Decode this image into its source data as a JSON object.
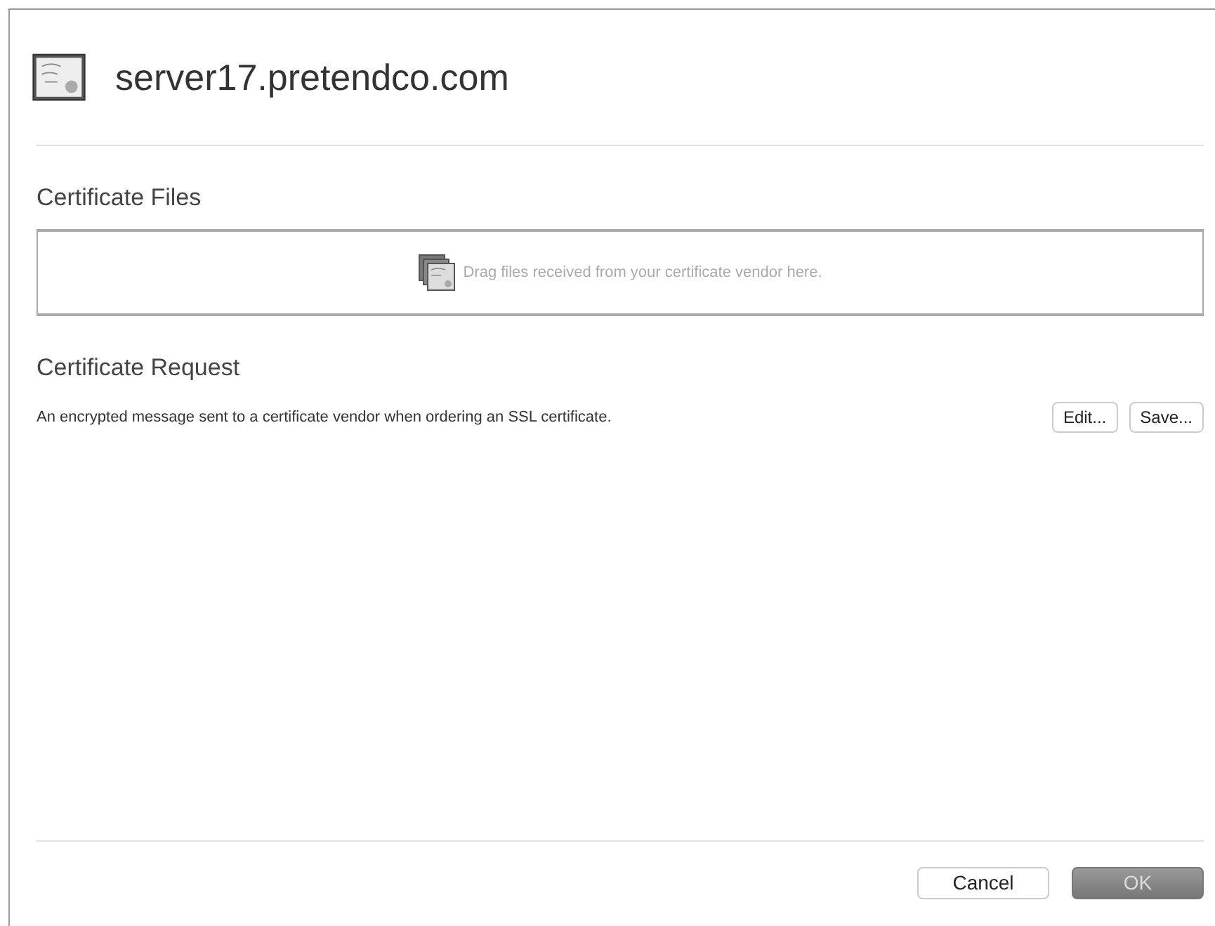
{
  "header": {
    "title": "server17.pretendco.com"
  },
  "certificate_files": {
    "heading": "Certificate Files",
    "drop_hint": "Drag files received from your certificate vendor here."
  },
  "certificate_request": {
    "heading": "Certificate Request",
    "description": "An encrypted message sent to a certificate vendor when ordering an SSL certificate.",
    "buttons": [
      {
        "label": "Edit..."
      },
      {
        "label": "Save..."
      }
    ]
  },
  "footer_buttons": [
    {
      "label": "Cancel",
      "kind": "normal"
    },
    {
      "label": "OK",
      "kind": "default"
    }
  ]
}
